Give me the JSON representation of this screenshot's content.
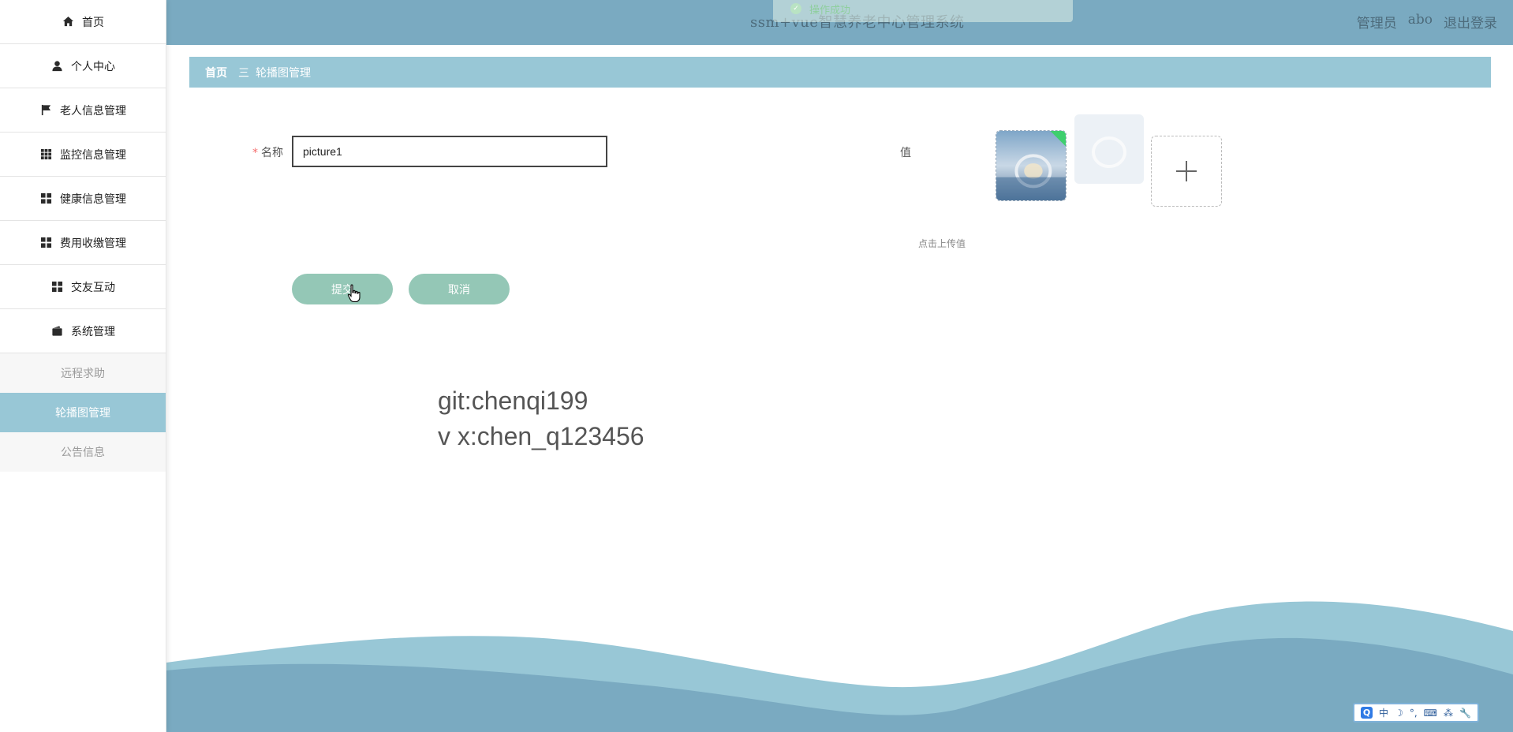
{
  "sidebar": {
    "items": [
      {
        "label": "首页",
        "icon": "home-icon"
      },
      {
        "label": "个人中心",
        "icon": "user-icon"
      },
      {
        "label": "老人信息管理",
        "icon": "flag-icon"
      },
      {
        "label": "监控信息管理",
        "icon": "grid-icon"
      },
      {
        "label": "健康信息管理",
        "icon": "grid-icon"
      },
      {
        "label": "费用收缴管理",
        "icon": "grid-icon"
      },
      {
        "label": "交友互动",
        "icon": "grid-icon"
      },
      {
        "label": "系统管理",
        "icon": "wallet-icon"
      }
    ],
    "submenu": [
      {
        "label": "远程求助",
        "active": false
      },
      {
        "label": "轮播图管理",
        "active": true
      },
      {
        "label": "公告信息",
        "active": false
      }
    ]
  },
  "header": {
    "title": "ssm+vue智慧养老中心管理系统",
    "role": "管理员",
    "username": "abo",
    "logout": "退出登录",
    "toast": "操作成功"
  },
  "breadcrumb": {
    "home": "首页",
    "separator": "三",
    "current": "轮播图管理"
  },
  "form": {
    "name_label": "名称",
    "required_mark": "*",
    "name_value": "picture1",
    "value_label": "值",
    "upload_hint": "点击上传值",
    "submit_label": "提交",
    "cancel_label": "取消"
  },
  "watermark": {
    "line1": "git:chenqi199",
    "line2": "v x:chen_q123456"
  },
  "ime": {
    "mode": "中",
    "symbols": "°,",
    "logo": "Q"
  },
  "colors": {
    "header_bg": "#7aaac1",
    "breadcrumb_bg": "#98c7d6",
    "active_menu_bg": "#98c7d6",
    "button_bg": "#94c7b6",
    "wave_light": "#98c7d6",
    "wave_dark": "#7aaac1"
  }
}
